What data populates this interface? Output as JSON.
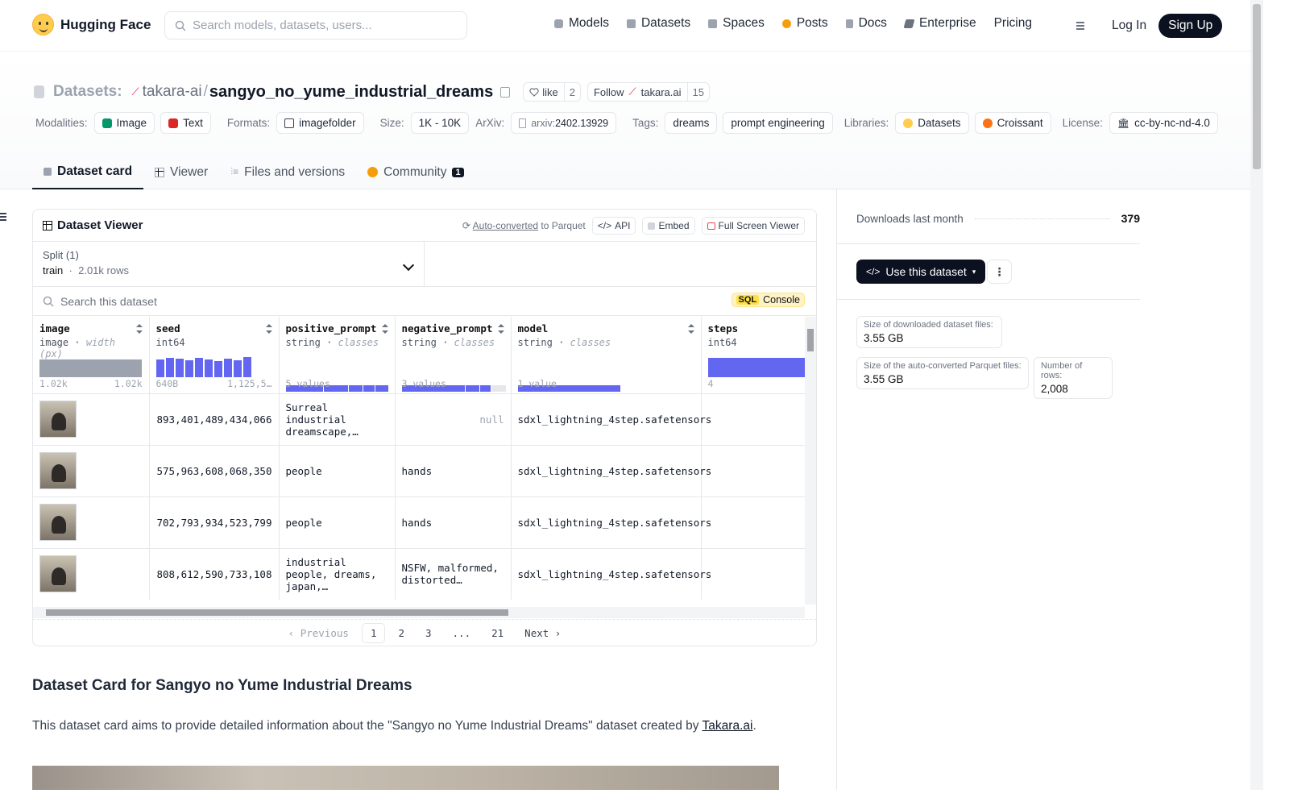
{
  "nav": {
    "brand": "Hugging Face",
    "search_placeholder": "Search models, datasets, users...",
    "links": [
      {
        "label": "Models",
        "icon": "cube-icon",
        "color": "#9ca3af"
      },
      {
        "label": "Datasets",
        "icon": "database-icon",
        "color": "#9ca3af"
      },
      {
        "label": "Spaces",
        "icon": "grid-icon",
        "color": "#9ca3af"
      },
      {
        "label": "Posts",
        "icon": "posts-icon",
        "color": "#f59e0b"
      },
      {
        "label": "Docs",
        "icon": "docs-icon",
        "color": "#9ca3af"
      },
      {
        "label": "Enterprise",
        "icon": "enterprise-icon",
        "color": "#6b7280"
      },
      {
        "label": "Pricing",
        "icon": "",
        "color": ""
      }
    ],
    "login": "Log In",
    "signup": "Sign Up"
  },
  "header": {
    "crumb_label": "Datasets:",
    "org": "takara-ai",
    "slash": "/",
    "repo": "sangyo_no_yume_industrial_dreams",
    "like_label": "like",
    "like_count": "2",
    "follow_label": "Follow",
    "follow_org": "takara.ai",
    "follow_count": "15",
    "meta": {
      "modalities_label": "Modalities:",
      "modalities": [
        "Image",
        "Text"
      ],
      "formats_label": "Formats:",
      "format": "imagefolder",
      "size_label": "Size:",
      "size": "1K - 10K",
      "arxiv_label": "ArXiv:",
      "arxiv_prefix": "arxiv:",
      "arxiv_id": "2402.13929",
      "tags_label": "Tags:",
      "tags": [
        "dreams",
        "prompt engineering"
      ],
      "libraries_label": "Libraries:",
      "libraries": [
        "Datasets",
        "Croissant"
      ],
      "license_label": "License:",
      "license": "cc-by-nc-nd-4.0"
    },
    "tabs": [
      {
        "label": "Dataset card",
        "active": true
      },
      {
        "label": "Viewer",
        "active": false
      },
      {
        "label": "Files and versions",
        "active": false
      },
      {
        "label": "Community",
        "active": false,
        "badge": "1"
      }
    ]
  },
  "viewer": {
    "title": "Dataset Viewer",
    "auto_converted": "Auto-converted",
    "to_parquet": "to Parquet",
    "api": "API",
    "embed": "Embed",
    "fullscreen": "Full Screen Viewer",
    "split_label": "Split (1)",
    "split_name": "train",
    "split_dot": "·",
    "split_rows": "2.01k rows",
    "search_placeholder": "Search this dataset",
    "sql": "SQL",
    "console": "Console",
    "columns": [
      {
        "name": "image",
        "type": "image",
        "extra": "width (px)",
        "foot_left": "1.02k",
        "foot_right": "1.02k"
      },
      {
        "name": "seed",
        "type": "int64",
        "extra": "",
        "foot_left": "640B",
        "foot_right": "1,125,5…"
      },
      {
        "name": "positive_prompt",
        "type": "string",
        "extra": "classes",
        "foot_left": "5 values",
        "foot_right": ""
      },
      {
        "name": "negative_prompt",
        "type": "string",
        "extra": "classes",
        "foot_left": "3 values",
        "foot_right": ""
      },
      {
        "name": "model",
        "type": "string",
        "extra": "classes",
        "foot_left": "1 value",
        "foot_right": ""
      },
      {
        "name": "steps",
        "type": "int64",
        "extra": "",
        "foot_left": "4",
        "foot_right": ""
      }
    ],
    "rows": [
      {
        "seed": "893,401,489,434,066",
        "positive": "Surreal industrial dreamscape,…",
        "negative": "null",
        "model": "sdxl_lightning_4step.safetensors"
      },
      {
        "seed": "575,963,608,068,350",
        "positive": "people",
        "negative": "hands",
        "model": "sdxl_lightning_4step.safetensors"
      },
      {
        "seed": "702,793,934,523,799",
        "positive": "people",
        "negative": "hands",
        "model": "sdxl_lightning_4step.safetensors"
      },
      {
        "seed": "808,612,590,733,108",
        "positive": "industrial people, dreams, japan,…",
        "negative": "NSFW, malformed, distorted…",
        "model": "sdxl_lightning_4step.safetensors"
      }
    ],
    "pager": {
      "prev": "Previous",
      "pages": [
        "1",
        "2",
        "3",
        "...",
        "21"
      ],
      "next": "Next",
      "current": "1"
    }
  },
  "sidebar": {
    "downloads_label": "Downloads last month",
    "downloads_value": "379",
    "use_button": "Use this dataset",
    "stats": [
      {
        "label": "Size of downloaded dataset files:",
        "value": "3.55 GB"
      },
      {
        "label": "Size of the auto-converted Parquet files:",
        "value": "3.55 GB"
      },
      {
        "label": "Number of rows:",
        "value": "2,008"
      }
    ]
  },
  "card": {
    "heading": "Dataset Card for Sangyo no Yume Industrial Dreams",
    "intro": "This dataset card aims to provide detailed information about the \"Sangyo no Yume Industrial Dreams\" dataset created by ",
    "link": "Takara.ai",
    "period": "."
  }
}
